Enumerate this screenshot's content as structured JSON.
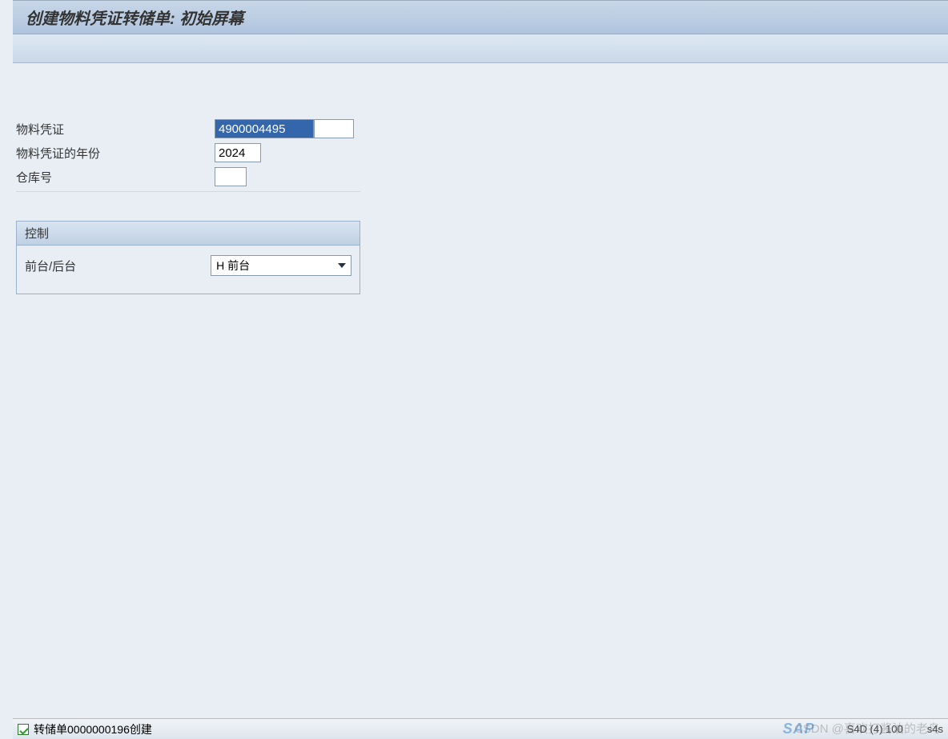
{
  "header": {
    "title": "创建物料凭证转储单: 初始屏幕"
  },
  "form": {
    "material_doc_label": "物料凭证",
    "material_doc_value": "4900004495",
    "material_doc_ext_value": "",
    "year_label": "物料凭证的年份",
    "year_value": "2024",
    "warehouse_label": "仓库号",
    "warehouse_value": ""
  },
  "group": {
    "title": "控制",
    "fg_bg_label": "前台/后台",
    "fg_bg_value": "H 前台"
  },
  "status": {
    "message": "转储单0000000196创建",
    "sap_logo": "SAP",
    "right_text": "S4D (4) 100",
    "right_text2": "s4s"
  },
  "watermark": "CSDN @喜欢打酱油的老鸟"
}
